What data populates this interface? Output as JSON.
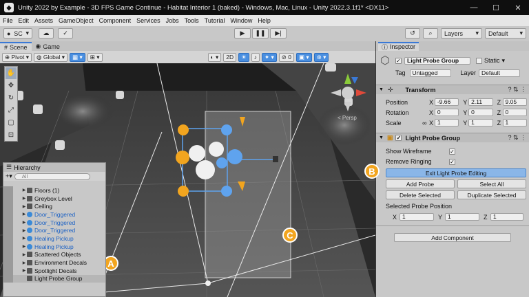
{
  "titlebar": {
    "title": "Unity 2022 by Example - 3D FPS Game Continue - Habitat Interior 1 (baked) - Windows, Mac, Linux - Unity 2022.3.1f1* <DX11>",
    "minimize": "—",
    "maximize": "☐",
    "close": "✕"
  },
  "menu": [
    "File",
    "Edit",
    "Assets",
    "GameObject",
    "Component",
    "Services",
    "Jobs",
    "Tools",
    "Tutorial",
    "Window",
    "Help"
  ],
  "toolbar": {
    "account": "SC",
    "layers": "Layers",
    "layout": "Default"
  },
  "tabs": {
    "scene": "Scene",
    "game": "Game"
  },
  "scenebar": {
    "pivot": "Pivot",
    "global": "Global",
    "mode_2d": "2D"
  },
  "viewport": {
    "persp_label": "< Persp"
  },
  "hierarchy": {
    "title": "Hierarchy",
    "search_placeholder": "All",
    "items": [
      {
        "label": "Floors (1)",
        "blue": false
      },
      {
        "label": "Greybox Level",
        "blue": false
      },
      {
        "label": "Ceiling",
        "blue": false
      },
      {
        "label": "Door_Triggered",
        "blue": true
      },
      {
        "label": "Door_Triggered",
        "blue": true
      },
      {
        "label": "Door_Triggered",
        "blue": true
      },
      {
        "label": "Healing Pickup",
        "blue": true
      },
      {
        "label": "Healing Pickup",
        "blue": true
      },
      {
        "label": "Scattered Objects",
        "blue": false
      },
      {
        "label": "Environment Decals",
        "blue": false
      },
      {
        "label": "Spotlight Decals",
        "blue": false
      },
      {
        "label": "Light Probe Group",
        "blue": false
      }
    ]
  },
  "inspector": {
    "tab": "Inspector",
    "object_name": "Light Probe Group",
    "static_label": "Static",
    "tag_label": "Tag",
    "tag_value": "Untagged",
    "layer_label": "Layer",
    "layer_value": "Default",
    "transform": {
      "title": "Transform",
      "position_label": "Position",
      "px": "-9.66",
      "py": "2.11",
      "pz": "9.05",
      "rotation_label": "Rotation",
      "rx": "0",
      "ry": "0",
      "rz": "0",
      "scale_label": "Scale",
      "sx": "1",
      "sy": "1",
      "sz": "1"
    },
    "lpg": {
      "title": "Light Probe Group",
      "show_wireframe": "Show Wireframe",
      "remove_ringing": "Remove Ringing",
      "exit_editing": "Exit Light Probe Editing",
      "add_probe": "Add Probe",
      "select_all": "Select All",
      "delete_selected": "Delete Selected",
      "duplicate_selected": "Duplicate Selected",
      "selected_probe_position": "Selected Probe Position",
      "sel_x": "1",
      "sel_y": "1",
      "sel_z": "1"
    },
    "add_component": "Add Component"
  },
  "callouts": {
    "a": "A",
    "b": "B",
    "c": "C"
  },
  "colors": {
    "callout": "#f2a51f",
    "probe_orange": "#f2a51f",
    "probe_blue": "#5fa3ee",
    "accent": "#3a79d6"
  }
}
